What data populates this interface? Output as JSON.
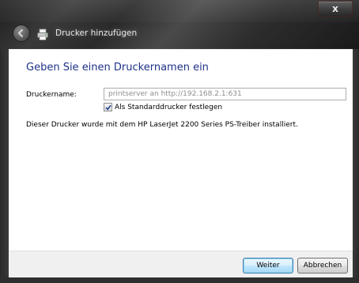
{
  "window": {
    "title": "Drucker hinzufügen",
    "close_symbol": "x"
  },
  "icons": {
    "back": "back-arrow-icon",
    "printer": "printer-icon",
    "checkmark": "checkmark-icon"
  },
  "page": {
    "heading": "Geben Sie einen Druckernamen ein",
    "printer_name_label": "Druckername:",
    "printer_name_value": "printserver an http://192.168.2.1:631",
    "default_printer_checkbox": {
      "label": "Als Standarddrucker festlegen",
      "checked": true
    },
    "info_text": "Dieser Drucker wurde mit dem HP LaserJet 2200 Series PS-Treiber installiert."
  },
  "buttons": {
    "next_label": "Weiter",
    "cancel_label": "Abbrechen"
  },
  "colors": {
    "heading": "#1e3287",
    "input_text": "#8d8d8d",
    "default_button_border": "#3c7fb1"
  }
}
